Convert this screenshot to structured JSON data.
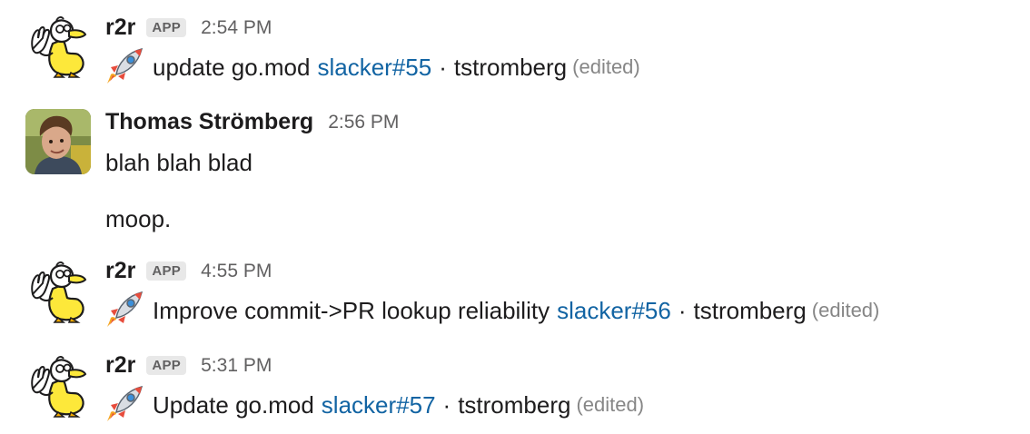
{
  "messages": [
    {
      "sender": "r2r",
      "badge": "APP",
      "time": "2:54 PM",
      "text": "update go.mod",
      "link": "slacker#55",
      "separator": "·",
      "author": "tstromberg",
      "edited": "(edited)",
      "emoji": "rocket-icon"
    },
    {
      "sender": "Thomas Strömberg",
      "time": "2:56 PM",
      "line1": "blah blah blad",
      "line2": "moop."
    },
    {
      "sender": "r2r",
      "badge": "APP",
      "time": "4:55 PM",
      "text": "Improve commit->PR lookup reliability",
      "link": "slacker#56",
      "separator": "·",
      "author": "tstromberg",
      "edited": "(edited)",
      "emoji": "rocket-icon"
    },
    {
      "sender": "r2r",
      "badge": "APP",
      "time": "5:31 PM",
      "text": "Update go.mod",
      "link": "slacker#57",
      "separator": "·",
      "author": "tstromberg",
      "edited": "(edited)",
      "emoji": "rocket-icon"
    }
  ],
  "colors": {
    "link": "#1264a3",
    "timestamp": "#616061",
    "edited": "#868686",
    "badge_bg": "#e8e8e8",
    "duck_yellow": "#fde83a"
  }
}
